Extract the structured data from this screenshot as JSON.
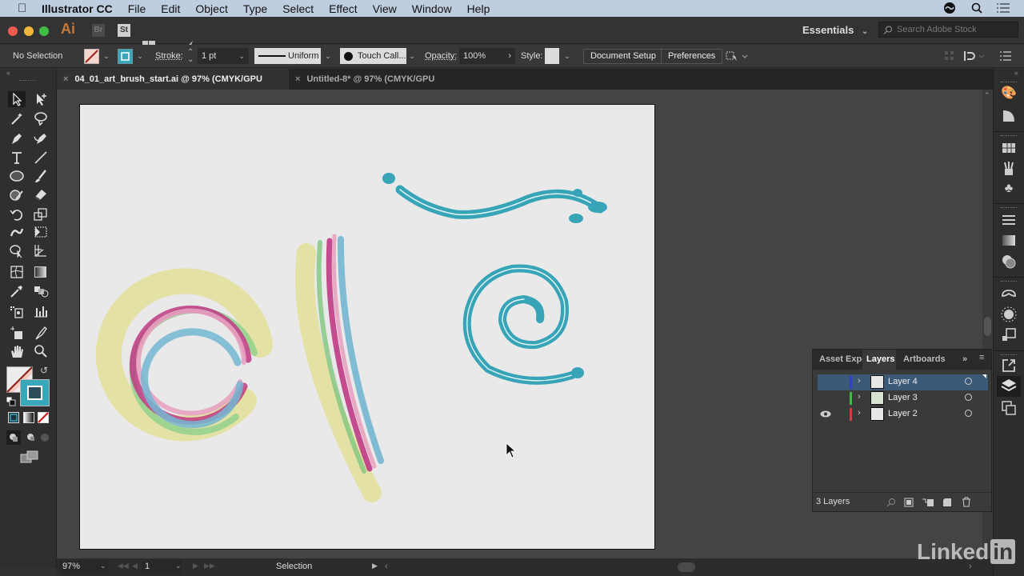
{
  "menubar": {
    "app_name": "Illustrator CC",
    "items": [
      "File",
      "Edit",
      "Object",
      "Type",
      "Select",
      "Effect",
      "View",
      "Window",
      "Help"
    ],
    "right_icons": [
      "creative-cloud-icon",
      "spotlight-search-icon",
      "notification-list-icon"
    ]
  },
  "appbar": {
    "logo": "Ai",
    "bridge_label": "Br",
    "stock_label": "St",
    "workspace": "Essentials",
    "search_placeholder": "Search Adobe Stock"
  },
  "controlbar": {
    "selection_status": "No Selection",
    "stroke_label": "Stroke:",
    "stroke_weight": "1 pt",
    "variable_width_profile": "Uniform",
    "brush_definition": "Touch Call...",
    "opacity_label": "Opacity:",
    "opacity_value": "100%",
    "style_label": "Style:",
    "document_setup": "Document Setup",
    "preferences": "Preferences",
    "colors": {
      "fill": "#f4d7cf",
      "stroke": "#3aa6b9"
    }
  },
  "tabs": [
    {
      "title": "04_01_art_brush_start.ai @ 97% (CMYK/GPU Preview)",
      "active": true
    },
    {
      "title": "Untitled-8* @ 97% (CMYK/GPU Preview)",
      "active": false
    }
  ],
  "tools": [
    "selection-tool",
    "direct-selection-tool",
    "magic-wand-tool",
    "lasso-tool",
    "pen-tool",
    "curvature-tool",
    "type-tool",
    "line-segment-tool",
    "ellipse-tool",
    "paintbrush-tool",
    "shaper-tool",
    "eraser-tool",
    "rotate-tool",
    "scale-tool",
    "puppet-warp-tool",
    "free-transform-tool",
    "shape-builder-tool",
    "perspective-grid-tool",
    "mesh-tool",
    "gradient-tool",
    "eyedropper-tool",
    "blend-tool",
    "symbol-sprayer-tool",
    "column-graph-tool",
    "artboard-tool",
    "slice-tool",
    "hand-tool",
    "zoom-tool"
  ],
  "statusbar": {
    "zoom": "97%",
    "artboard_number": "1",
    "current_tool": "Selection"
  },
  "layers_panel": {
    "tabs": [
      "Asset Expo",
      "Layers",
      "Artboards"
    ],
    "active_tab": "Layers",
    "layers": [
      {
        "name": "Layer 4",
        "color": "#2f3fd0",
        "visible": false,
        "selected": true
      },
      {
        "name": "Layer 3",
        "color": "#3fbf3f",
        "visible": false,
        "selected": false
      },
      {
        "name": "Layer 2",
        "color": "#d04040",
        "visible": true,
        "selected": false
      }
    ],
    "count_label": "3 Layers"
  },
  "dock_icons": [
    "color-guide-icon",
    "color-icon",
    "swatches-icon",
    "brushes-icon",
    "symbols-icon",
    "stroke-icon",
    "gradient-icon",
    "transparency-icon",
    "cc-libraries-icon",
    "appearance-icon",
    "graphic-styles-icon",
    "export-icon",
    "layers-icon",
    "artboards-icon"
  ],
  "watermark": {
    "linkedin": "Linked",
    "in": "in"
  }
}
